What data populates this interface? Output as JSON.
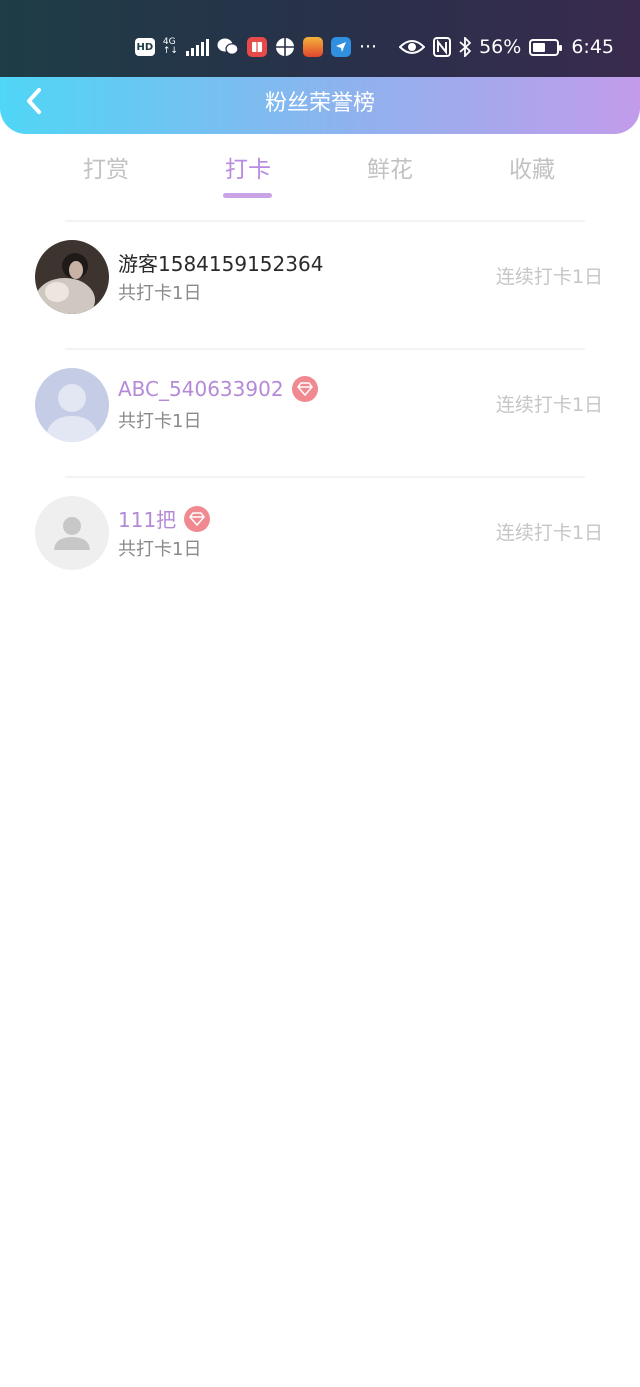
{
  "status_bar": {
    "hd_badge": "HD",
    "network": "4G",
    "network_sub": "↑↓",
    "more": "···",
    "battery_percent": "56%",
    "battery_level": 0.56,
    "time": "6:45"
  },
  "header": {
    "title": "粉丝荣誉榜"
  },
  "tabs": [
    {
      "label": "打赏",
      "active": false
    },
    {
      "label": "打卡",
      "active": true
    },
    {
      "label": "鲜花",
      "active": false
    },
    {
      "label": "收藏",
      "active": false
    }
  ],
  "fans": [
    {
      "name": "游客1584159152364",
      "subtitle": "共打卡1日",
      "streak": "连续打卡1日",
      "vip": false
    },
    {
      "name": "ABC_540633902",
      "subtitle": "共打卡1日",
      "streak": "连续打卡1日",
      "vip": true
    },
    {
      "name": "111把",
      "subtitle": "共打卡1日",
      "streak": "连续打卡1日",
      "vip": true
    }
  ],
  "colors": {
    "accent": "#b88be0",
    "vip_name": "#b48ad8",
    "gem": "#f08a90",
    "header_start": "#4fd6f6",
    "header_end": "#c29ceb"
  }
}
